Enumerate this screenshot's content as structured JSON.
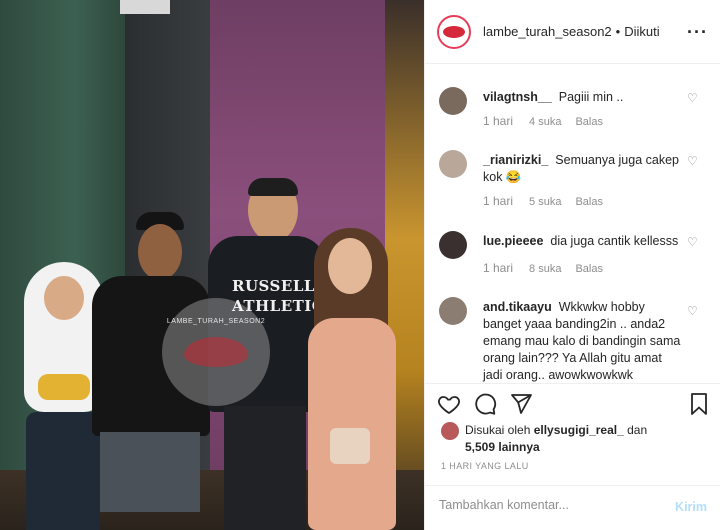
{
  "post": {
    "username": "lambe_turah_season2",
    "separator": "•",
    "follow_status": "Diikuti",
    "more_icon": "more-options-icon",
    "photo": {
      "watermark_text": "LAMBE_TURAH_SEASON2",
      "shirt_line1": "RUSSELL",
      "shirt_line2": "ATHLETIC"
    }
  },
  "comments": [
    {
      "user": "vilagtnsh__",
      "text": "Pagiii min ..",
      "time": "1 hari",
      "likes": "4 suka",
      "reply": "Balas",
      "avatar_color": "#7a6a5e"
    },
    {
      "user": "_rianirizki_",
      "text": "Semuanya juga cakep kok 😂",
      "time": "1 hari",
      "likes": "5 suka",
      "reply": "Balas",
      "avatar_color": "#b9a79a"
    },
    {
      "user": "lue.pieeee",
      "text": "dia juga cantik kellesss",
      "time": "1 hari",
      "likes": "8 suka",
      "reply": "Balas",
      "avatar_color": "#3b3030"
    },
    {
      "user": "and.tikaayu",
      "text": "Wkkwkw hobby banget yaaa banding2in .. anda2 emang mau kalo di bandingin sama orang lain??? Ya Allah gitu amat jadi orang.. awowkwowkwk",
      "time": "",
      "likes": "",
      "reply": "",
      "avatar_color": "#8c7d73"
    }
  ],
  "actions": {
    "like_icon": "heart-icon",
    "comment_icon": "comment-icon",
    "share_icon": "send-icon",
    "save_icon": "bookmark-icon"
  },
  "likes": {
    "prefix": "Disukai oleh",
    "user": "ellysugigi_real_",
    "connector": "dan",
    "count": "5,509 lainnya"
  },
  "date": "1 HARI YANG LALU",
  "add_comment": {
    "placeholder": "Tambahkan komentar...",
    "send_label": "Kirim"
  }
}
